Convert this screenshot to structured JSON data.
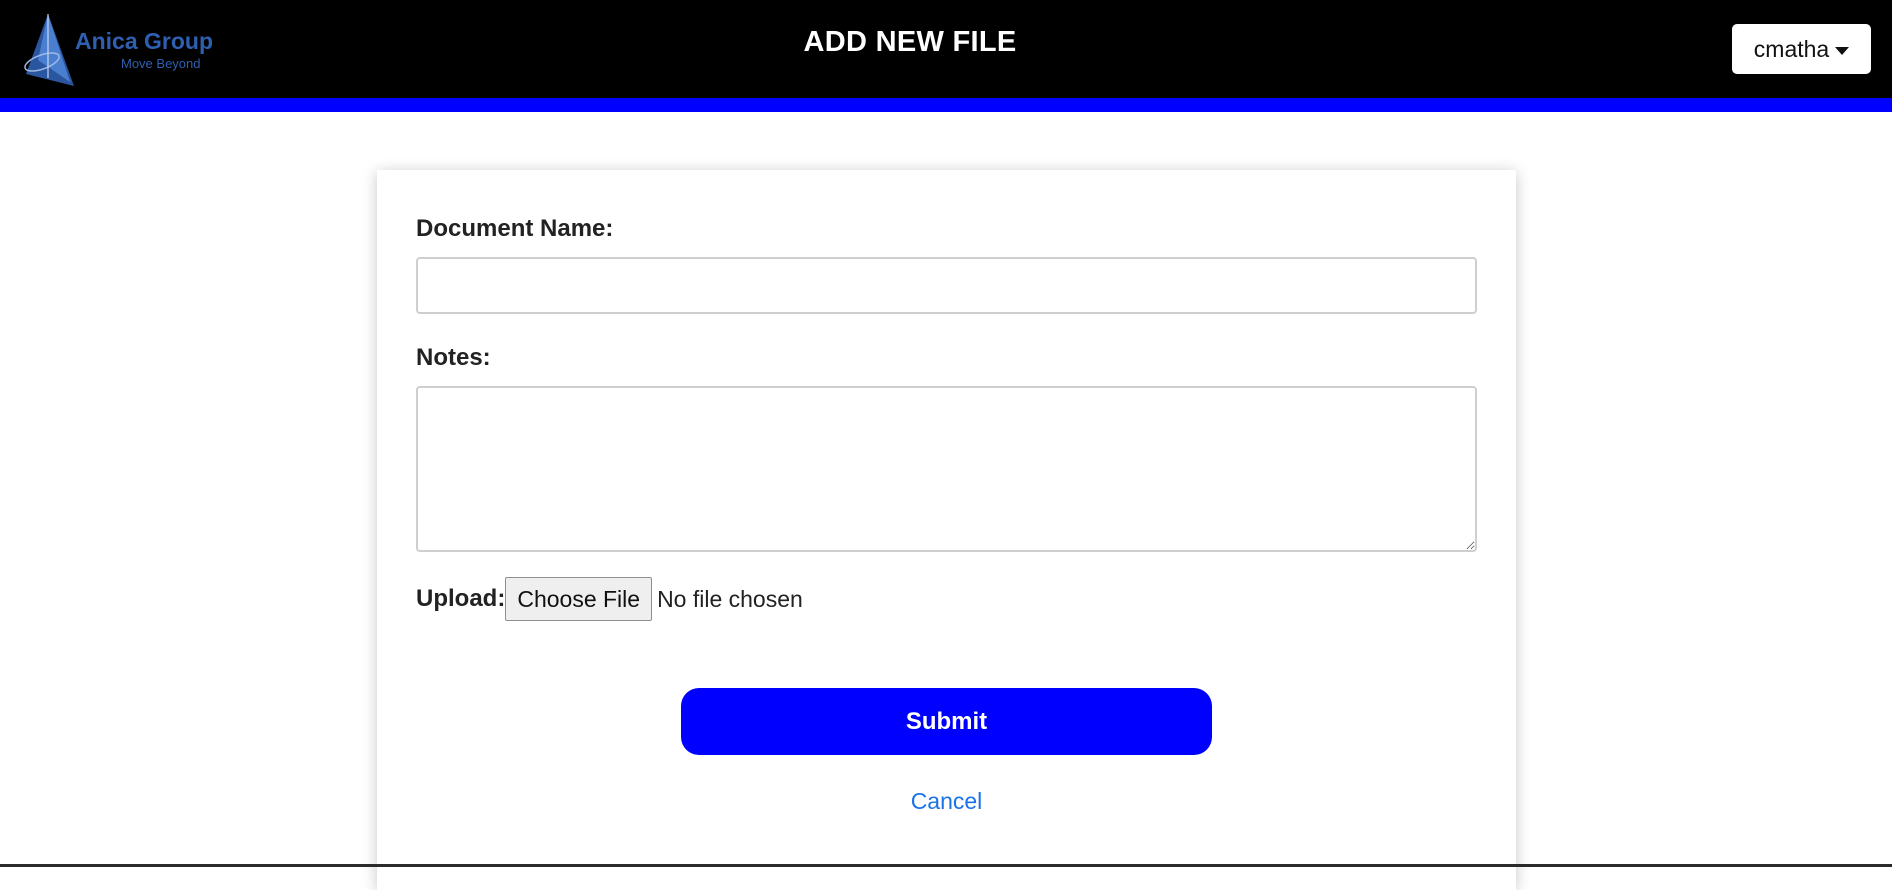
{
  "header": {
    "logo": {
      "name": "Anica Group",
      "tagline": "Move Beyond",
      "icon": "sail-logo-icon"
    },
    "title": "ADD NEW FILE",
    "user_menu": {
      "username": "cmatha",
      "icon": "caret-down-icon"
    }
  },
  "form": {
    "document_name": {
      "label": "Document Name:",
      "value": ""
    },
    "notes": {
      "label": "Notes:",
      "value": ""
    },
    "upload": {
      "label": "Upload:",
      "button_label": "Choose File",
      "status": "No file chosen"
    },
    "submit_label": "Submit",
    "cancel_label": "Cancel"
  },
  "colors": {
    "header_bg": "#000000",
    "accent": "#0000ff",
    "link": "#1a73e8",
    "logo": "#2f5fb0"
  }
}
